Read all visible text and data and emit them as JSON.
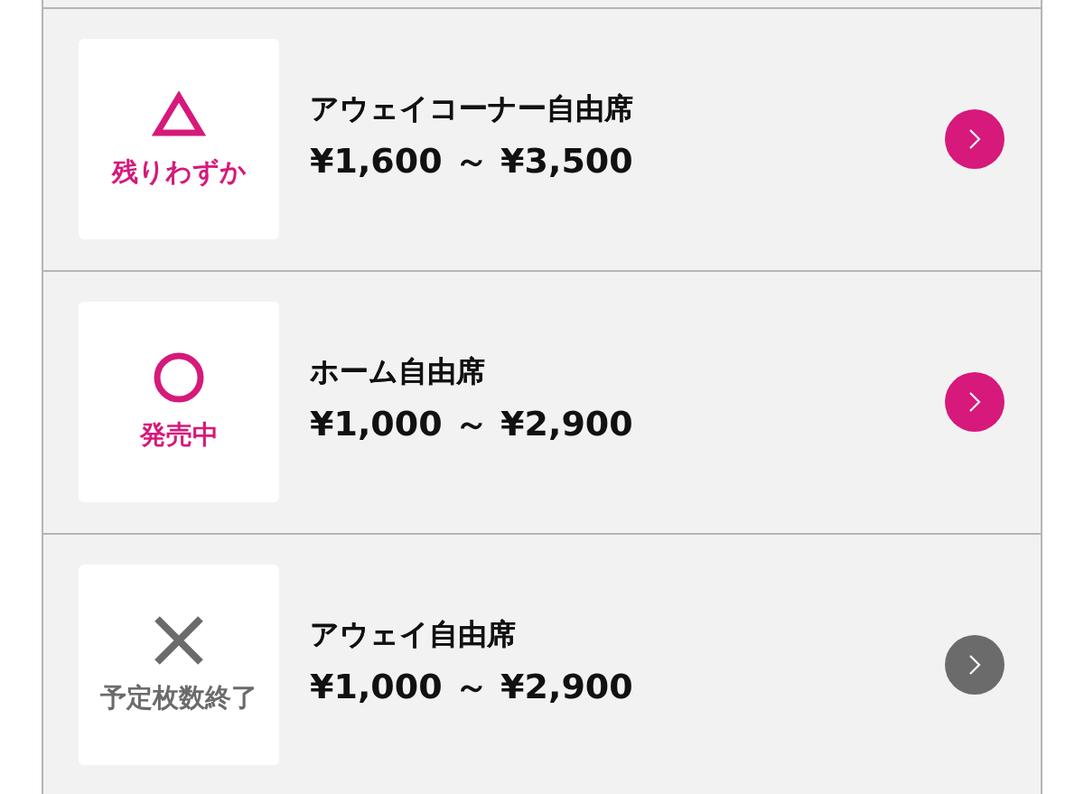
{
  "seats": [
    {
      "status": {
        "kind": "few",
        "label": "残りわずか"
      },
      "name": "アウェイコーナー自由席",
      "price": "¥1,600 ～ ¥3,500"
    },
    {
      "status": {
        "kind": "available",
        "label": "発売中"
      },
      "name": "ホーム自由席",
      "price": "¥1,000 ～ ¥2,900"
    },
    {
      "status": {
        "kind": "soldout",
        "label": "予定枚数終了"
      },
      "name": "アウェイ自由席",
      "price": "¥1,000 ～ ¥2,900"
    }
  ]
}
